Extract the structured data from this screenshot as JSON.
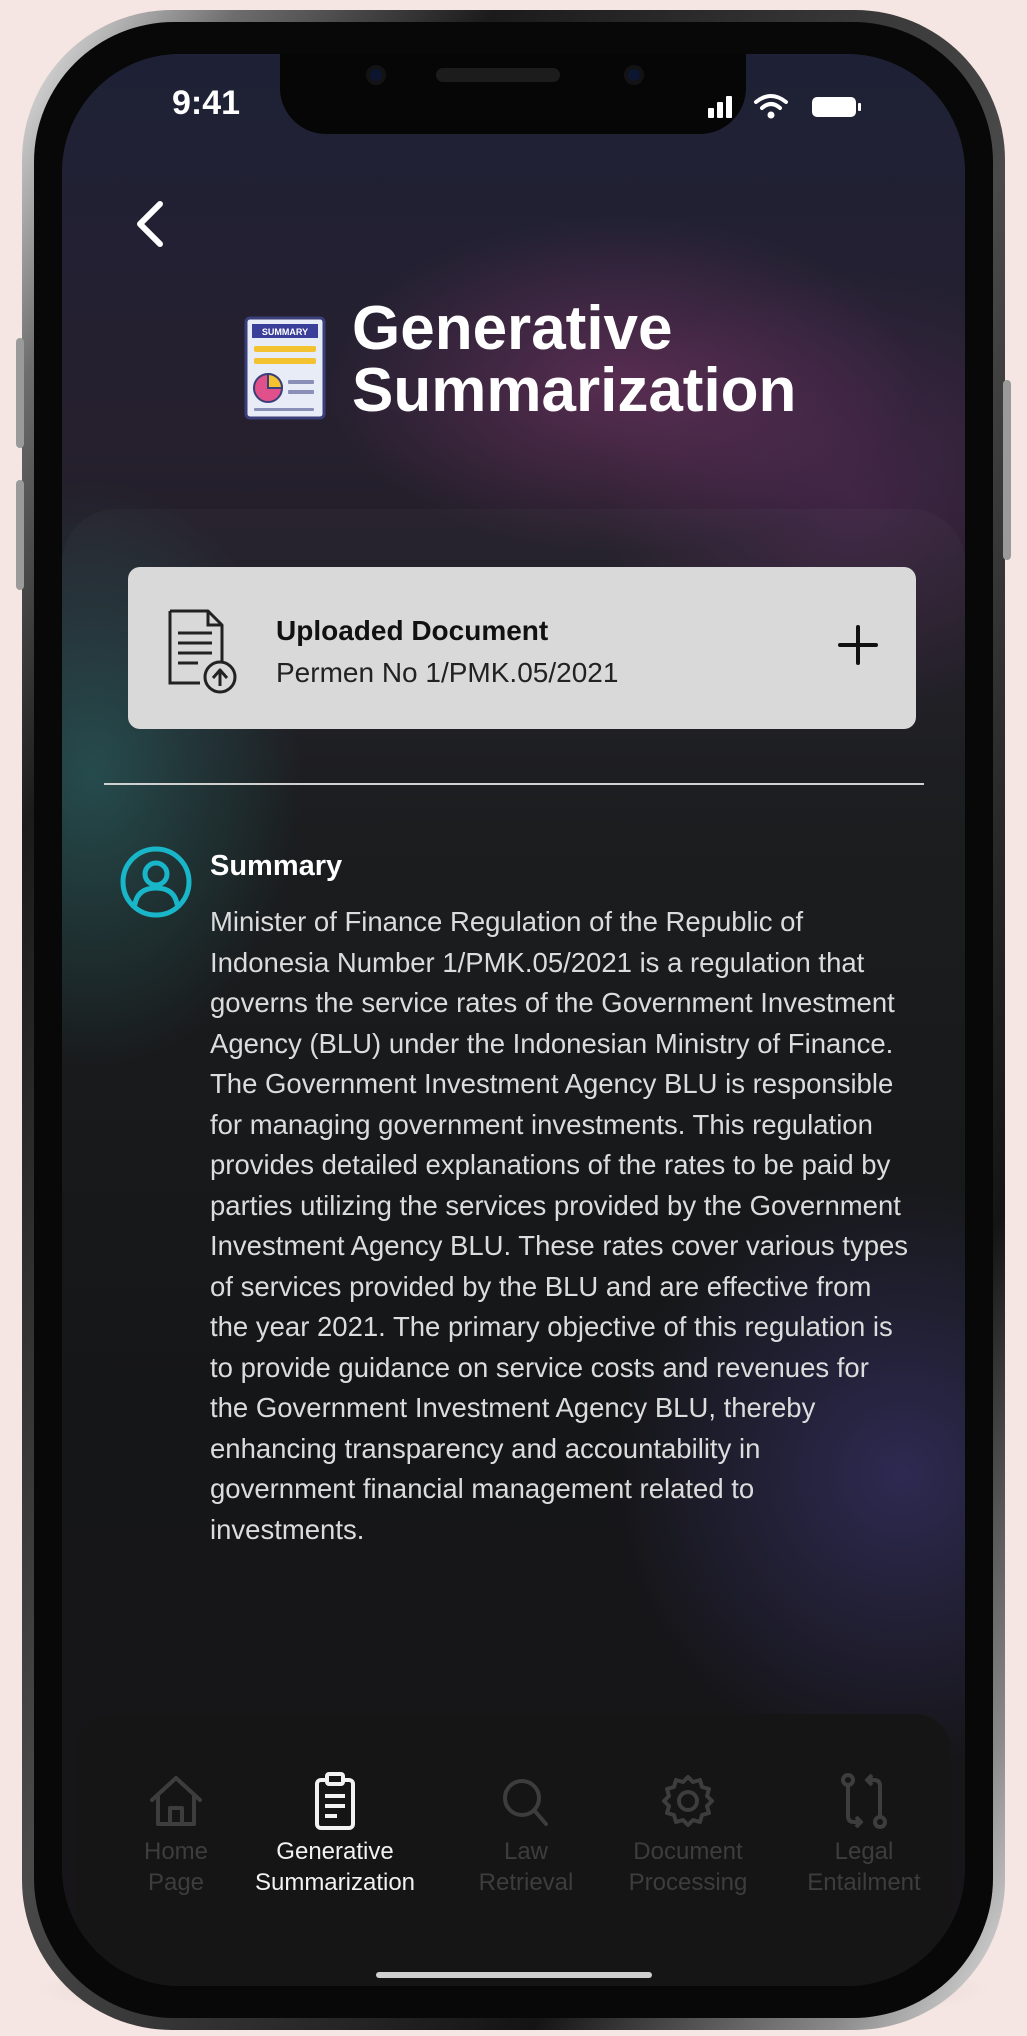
{
  "status_bar": {
    "time": "9:41"
  },
  "header": {
    "title_line1": "Generative",
    "title_line2": "Summarization",
    "logo_label": "SUMMARY"
  },
  "upload": {
    "title": "Uploaded Document",
    "filename": "Permen No 1/PMK.05/2021"
  },
  "summary": {
    "title": "Summary",
    "text": "Minister of Finance Regulation of the Republic of Indonesia Number 1/PMK.05/2021 is a regulation that governs the service rates of the Government Investment Agency (BLU) under the Indonesian Ministry of Finance. The Government Investment Agency BLU is responsible for managing government investments. This regulation provides detailed explanations of the rates to be paid by parties utilizing the services provided by the Government Investment Agency BLU. These rates cover various types of services provided by the BLU and are effective from the year 2021. The primary objective of this regulation is to provide guidance on service costs and revenues for the Government Investment Agency BLU, thereby enhancing transparency and accountability in government financial management related to investments."
  },
  "nav": {
    "active_index": 1,
    "items": [
      {
        "line1": "Home",
        "line2": "Page",
        "icon": "home-icon"
      },
      {
        "line1": "Generative",
        "line2": "Summarization",
        "icon": "clipboard-icon"
      },
      {
        "line1": "Law",
        "line2": "Retrieval",
        "icon": "search-icon"
      },
      {
        "line1": "Document",
        "line2": "Processing",
        "icon": "gear-icon"
      },
      {
        "line1": "Legal",
        "line2": "Entailment",
        "icon": "git-compare-icon"
      }
    ]
  },
  "colors": {
    "accent": "#18b6c8",
    "card": "#d9d9d9",
    "nav_inactive": "#3d3d3d",
    "nav_active": "#f2f2f2"
  }
}
